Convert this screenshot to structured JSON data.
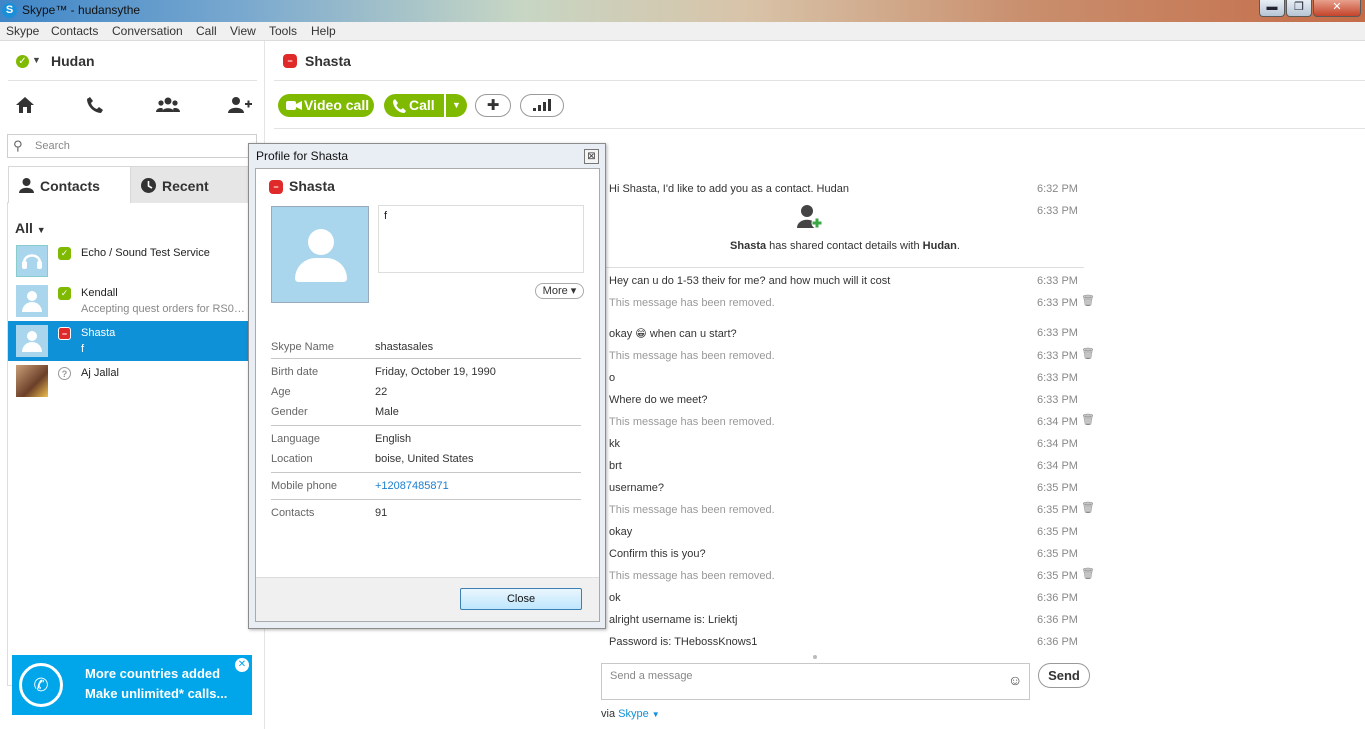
{
  "window": {
    "title": "Skype™ - hudansythe",
    "controls": {
      "minimize": "▬",
      "maximize": "❐",
      "close": "✕"
    }
  },
  "menu": [
    "Skype",
    "Contacts",
    "Conversation",
    "Call",
    "View",
    "Tools",
    "Help"
  ],
  "me": {
    "name": "Hudan",
    "status": "online"
  },
  "search": {
    "placeholder": "Search"
  },
  "tabs": {
    "contacts": "Contacts",
    "recent": "Recent"
  },
  "filter": "All",
  "contacts": [
    {
      "name": "Echo / Sound Test Service",
      "mood": "",
      "status": "online"
    },
    {
      "name": "Kendall",
      "mood": "Accepting quest orders for RS07...",
      "status": "online"
    },
    {
      "name": "Shasta",
      "mood": "f",
      "status": "busy"
    },
    {
      "name": "Aj Jallal",
      "mood": "",
      "status": "unknown"
    }
  ],
  "promo": {
    "line1": "More countries added",
    "line2": "Make unlimited* calls..."
  },
  "chat": {
    "name": "Shasta",
    "buttons": {
      "video_call": "Video call",
      "call": "Call"
    },
    "shared_contact": {
      "sender": "Shasta",
      "middle": " has shared contact details with ",
      "receiver": "Hudan",
      "end": "."
    },
    "messages": [
      {
        "text": "Hi Shasta, I'd like to add you as a contact. Hudan",
        "time": "6:32 PM",
        "removed": false
      },
      {
        "text": "",
        "time": "6:33 PM",
        "removed": false
      },
      {
        "text": "Hey can u do 1-53 theiv for me? and how much will it cost",
        "time": "6:33 PM",
        "removed": false
      },
      {
        "text": "This message has been removed.",
        "time": "6:33 PM",
        "removed": true
      },
      {
        "text": "okay 😁 when can u start?",
        "time": "6:33 PM",
        "removed": false
      },
      {
        "text": "This message has been removed.",
        "time": "6:33 PM",
        "removed": true
      },
      {
        "text": "o",
        "time": "6:33 PM",
        "removed": false
      },
      {
        "text": "Where do we meet?",
        "time": "6:33 PM",
        "removed": false
      },
      {
        "text": "This message has been removed.",
        "time": "6:34 PM",
        "removed": true
      },
      {
        "text": "kk",
        "time": "6:34 PM",
        "removed": false
      },
      {
        "text": "brt",
        "time": "6:34 PM",
        "removed": false
      },
      {
        "text": "username?",
        "time": "6:35 PM",
        "removed": false
      },
      {
        "text": "This message has been removed.",
        "time": "6:35 PM",
        "removed": true
      },
      {
        "text": "okay",
        "time": "6:35 PM",
        "removed": false
      },
      {
        "text": "Confirm this is you?",
        "time": "6:35 PM",
        "removed": false
      },
      {
        "text": "This message has been removed.",
        "time": "6:35 PM",
        "removed": true
      },
      {
        "text": "ok",
        "time": "6:36 PM",
        "removed": false
      },
      {
        "text": "alright username is: Lriektj",
        "time": "6:36 PM",
        "removed": false
      },
      {
        "text": "Password is: THebossKnows1",
        "time": "6:36 PM",
        "removed": false
      }
    ],
    "compose_placeholder": "Send a message",
    "send": "Send",
    "via": "via",
    "via_link": "Skype"
  },
  "profile": {
    "title": "Profile for Shasta",
    "name": "Shasta",
    "mood": "f",
    "more": "More",
    "fields": {
      "skype_name": {
        "label": "Skype Name",
        "value": "shastasales"
      },
      "birth_date": {
        "label": "Birth date",
        "value": "Friday, October 19, 1990"
      },
      "age": {
        "label": "Age",
        "value": "22"
      },
      "gender": {
        "label": "Gender",
        "value": "Male"
      },
      "language": {
        "label": "Language",
        "value": "English"
      },
      "location": {
        "label": "Location",
        "value": "boise, United States"
      },
      "mobile": {
        "label": "Mobile phone",
        "value": "+12087485871"
      },
      "contacts": {
        "label": "Contacts",
        "value": "91"
      }
    },
    "close": "Close"
  },
  "colors": {
    "accent": "#0f91d8",
    "green": "#7fba00",
    "busy": "#e02a2a"
  }
}
